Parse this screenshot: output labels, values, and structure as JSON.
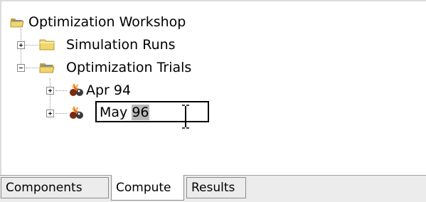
{
  "tree": {
    "root": {
      "label": "Optimization Workshop",
      "icon": "open-folder-icon"
    },
    "children": [
      {
        "label": "Simulation Runs",
        "icon": "folder-icon",
        "expanded": false
      },
      {
        "label": "Optimization Trials",
        "icon": "open-folder-icon",
        "expanded": true,
        "children": [
          {
            "label": "Apr 94",
            "icon": "trial-icon"
          },
          {
            "label": "May 96",
            "icon": "trial-icon",
            "editing": true
          }
        ]
      }
    ]
  },
  "edit": {
    "prefix": "May ",
    "selected": "96"
  },
  "tabs": [
    {
      "label": "Components",
      "active": false
    },
    {
      "label": "Compute",
      "active": true
    },
    {
      "label": "Results",
      "active": false
    }
  ],
  "colors": {
    "folder": "#f1d66a",
    "folder_dark": "#c8a23a",
    "selection": "#b9b9b9"
  }
}
